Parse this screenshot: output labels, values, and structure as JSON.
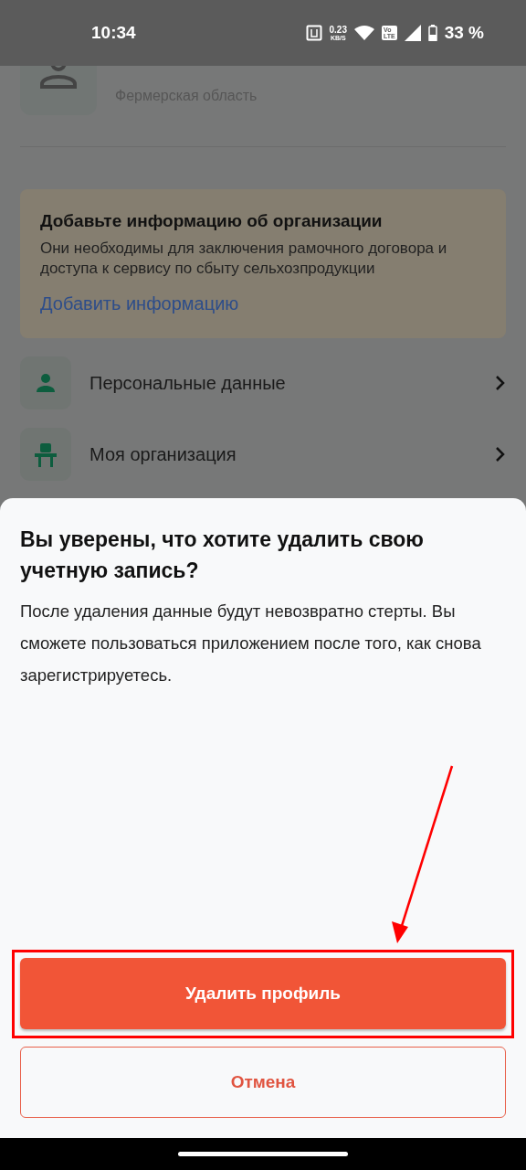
{
  "status_bar": {
    "time": "10:34",
    "speed_value": "0.23",
    "speed_unit": "KB/S",
    "volte_top": "Vo",
    "volte_bottom": "LTE",
    "battery": "33 %"
  },
  "profile": {
    "subtitle": "Фермерская область"
  },
  "info_card": {
    "title": "Добавьте информацию об организации",
    "text": "Они необходимы для заключения рамочного договора и доступа к сервису по сбыту сельхозпродукции",
    "link": "Добавить информацию"
  },
  "menu": [
    {
      "kind": "person",
      "label": "Персональные данные"
    },
    {
      "kind": "organization",
      "label": "Моя организация"
    }
  ],
  "dialog": {
    "title": "Вы уверены, что хотите удалить свою учетную запись?",
    "text": "После удаления данные будут невозвратно стерты. Вы сможете пользоваться приложением после того, как снова зарегистрируетесь.",
    "buttons": [
      {
        "kind": "primary",
        "label": "Удалить профиль"
      },
      {
        "kind": "outline",
        "label": "Отмена"
      }
    ]
  }
}
